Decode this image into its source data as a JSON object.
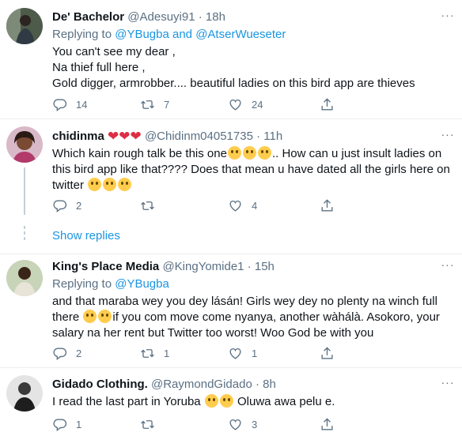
{
  "tweets": [
    {
      "name": "De' Bachelor",
      "handle": "@Adesuyi91",
      "time": "18h",
      "replying_prefix": "Replying to",
      "replying_to": [
        "@YBugba",
        "@AtserWueseter"
      ],
      "replying_and": "and",
      "text": "You can't see my dear ,\nNa thief full here ,\nGold digger, armrobber.... beautiful ladies on this bird app are thieves",
      "replies": "14",
      "retweets": "7",
      "likes": "24"
    },
    {
      "name": "chidinma",
      "handle": "@Chidinm04051735",
      "time": "11h",
      "text_a": "Which kain rough talk be this one",
      "text_b": ".. How can u just insult ladies on this bird app like that???? Does that mean u have dated all the girls here on twitter ",
      "replies": "2",
      "retweets": "",
      "likes": "4"
    },
    {
      "name": "King's Place Media",
      "handle": "@KingYomide1",
      "time": "15h",
      "replying_prefix": "Replying to",
      "replying_to": [
        "@YBugba"
      ],
      "text_a": "and that maraba wey you dey lásán! Girls wey dey no plenty na winch full there ",
      "text_b": "if you com move come nyanya, another wàhálà. Asokoro, your salary na her rent but Twitter too worst! Woo God be with you",
      "replies": "2",
      "retweets": "1",
      "likes": "1"
    },
    {
      "name": "Gidado Clothing.",
      "handle": "@RaymondGidado",
      "time": "8h",
      "text_a": "I read the last part in Yoruba ",
      "text_b": " Oluwa awa pelu e.",
      "replies": "1",
      "retweets": "",
      "likes": "3"
    }
  ],
  "show_replies": "Show replies",
  "separator": "·",
  "colors": {
    "link": "#1b95e0",
    "muted": "#5b7083",
    "text": "#0f1419"
  },
  "icons": [
    "reply-icon",
    "retweet-icon",
    "like-icon",
    "share-icon",
    "more-icon"
  ]
}
